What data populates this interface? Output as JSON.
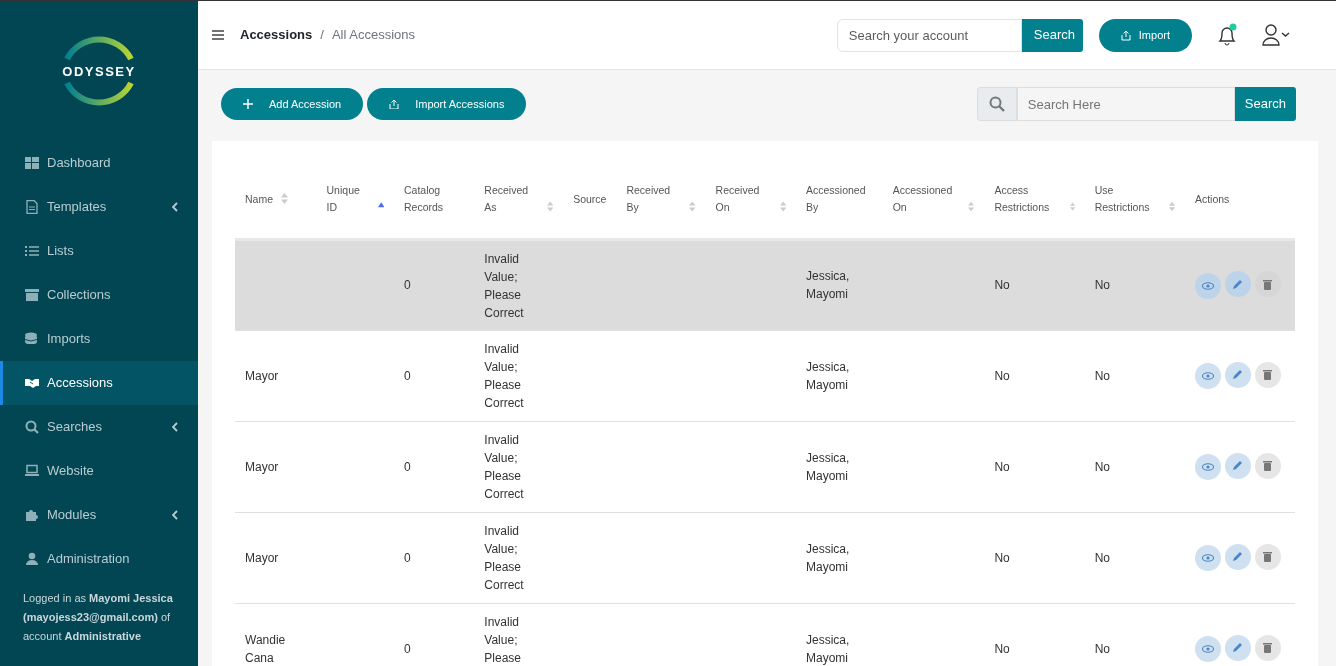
{
  "sidebar": {
    "logo": "ODYSSEY",
    "items": [
      {
        "label": "Dashboard",
        "selected": false,
        "submenu": false
      },
      {
        "label": "Templates",
        "selected": false,
        "submenu": true
      },
      {
        "label": "Lists",
        "selected": false,
        "submenu": false
      },
      {
        "label": "Collections",
        "selected": false,
        "submenu": false
      },
      {
        "label": "Imports",
        "selected": false,
        "submenu": false
      },
      {
        "label": "Accessions",
        "selected": true,
        "submenu": false
      },
      {
        "label": "Searches",
        "selected": false,
        "submenu": true
      },
      {
        "label": "Website",
        "selected": false,
        "submenu": false
      },
      {
        "label": "Modules",
        "selected": false,
        "submenu": true
      },
      {
        "label": "Administration",
        "selected": false,
        "submenu": false
      }
    ],
    "login_note": "Logged in as **Mayomi Jessica (mayojess23@gmail.com)** of account **Administrative**"
  },
  "topbar": {
    "breadcrumb": [
      "Accessions",
      "All Accessions"
    ],
    "breadcrumb_separator": "/",
    "search": {
      "placeholder": "Search your account",
      "button": "Search"
    },
    "import_button": "Import",
    "notification_dot": true
  },
  "toolbar": {
    "buttons": [
      "Add Accession",
      "Import Accessions"
    ],
    "search": {
      "placeholder": "Search Here",
      "button": "Search"
    }
  },
  "table": {
    "columns": [
      {
        "label": "Name",
        "sortable": true,
        "sorted": false
      },
      {
        "label": "Unique ID",
        "sortable": true,
        "sorted": true
      },
      {
        "label": "Catalog Records",
        "sortable": false
      },
      {
        "label": "Received As",
        "sortable": true,
        "sorted": false
      },
      {
        "label": "Source",
        "sortable": false
      },
      {
        "label": "Received By",
        "sortable": true,
        "sorted": false
      },
      {
        "label": "Received On",
        "sortable": true,
        "sorted": false
      },
      {
        "label": "Accessioned By",
        "sortable": false
      },
      {
        "label": "Accessioned On",
        "sortable": true,
        "sorted": false
      },
      {
        "label": "Access Restrictions",
        "sortable": true,
        "sorted": false
      },
      {
        "label": "Use Restrictions",
        "sortable": true,
        "sorted": false
      },
      {
        "label": "Actions",
        "sortable": false
      }
    ],
    "rows": [
      {
        "selected": true,
        "cells": [
          "",
          "",
          "0",
          "Invalid Value; Please Correct",
          "",
          "",
          "",
          "Jessica, Mayomi",
          "",
          "No",
          "No"
        ]
      },
      {
        "selected": false,
        "cells": [
          "Mayor",
          "",
          "0",
          "Invalid Value; Please Correct",
          "",
          "",
          "",
          "Jessica, Mayomi",
          "",
          "No",
          "No"
        ]
      },
      {
        "selected": false,
        "cells": [
          "Mayor",
          "",
          "0",
          "Invalid Value; Please Correct",
          "",
          "",
          "",
          "Jessica, Mayomi",
          "",
          "No",
          "No"
        ]
      },
      {
        "selected": false,
        "cells": [
          "Mayor",
          "",
          "0",
          "Invalid Value; Please Correct",
          "",
          "",
          "",
          "Jessica, Mayomi",
          "",
          "No",
          "No"
        ]
      },
      {
        "selected": false,
        "cells": [
          "Wandie Cana",
          "",
          "0",
          "Invalid Value; Please",
          "",
          "",
          "",
          "Jessica, Mayomi",
          "",
          "No",
          "No"
        ]
      }
    ]
  }
}
